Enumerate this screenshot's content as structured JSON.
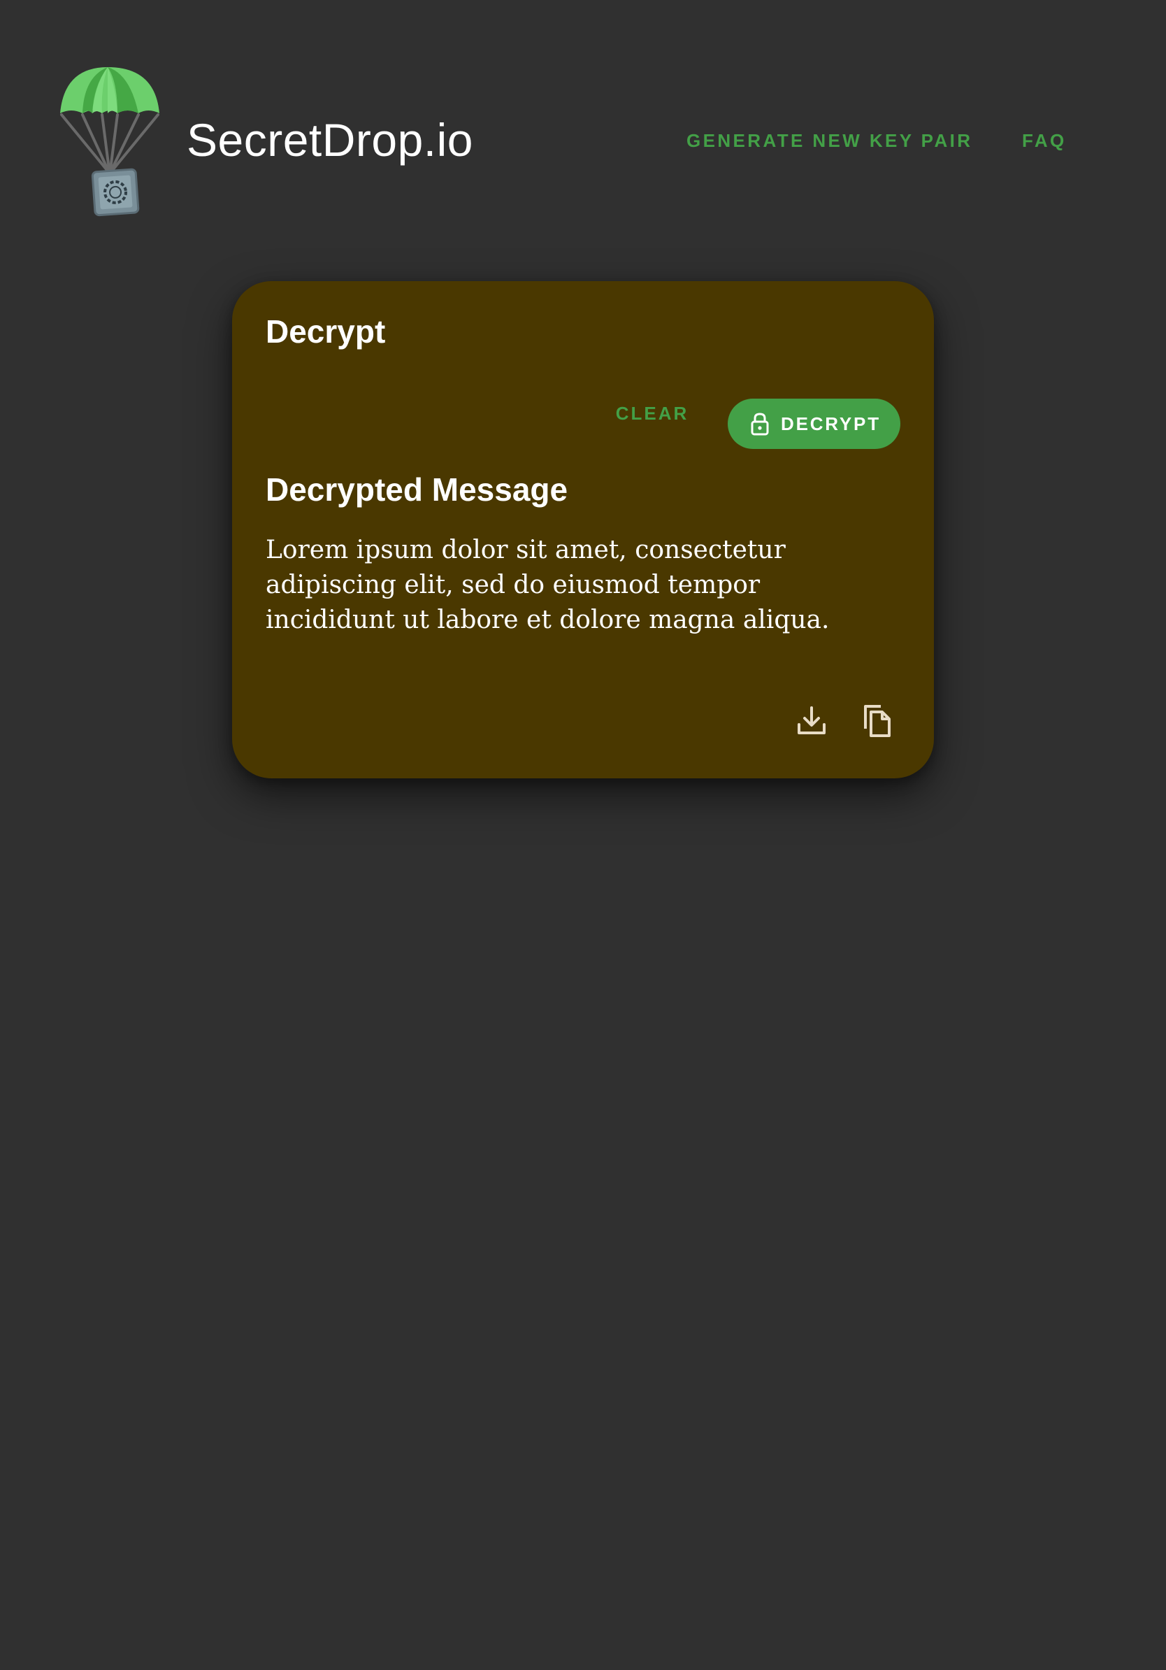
{
  "header": {
    "brand_name": "SecretDrop.io",
    "logo_icon": "parachute-safe-icon",
    "nav": {
      "generate": "GENERATE NEW KEY PAIR",
      "faq": "FAQ"
    }
  },
  "card": {
    "title": "Decrypt",
    "clear_label": "CLEAR",
    "decrypt_label": "DECRYPT",
    "decrypt_icon": "lock-icon",
    "message_heading": "Decrypted Message",
    "message_text": "Lorem ipsum dolor sit amet, consectetur adipiscing elit, sed do eiusmod tempor incididunt ut labore et dolore magna aliqua.",
    "actions": [
      "download-icon",
      "copy-icon"
    ]
  },
  "colors": {
    "background": "#303030",
    "card": "#4a3800",
    "accent": "#43a047",
    "text": "#ffffff",
    "icon": "#e8dcc6"
  }
}
